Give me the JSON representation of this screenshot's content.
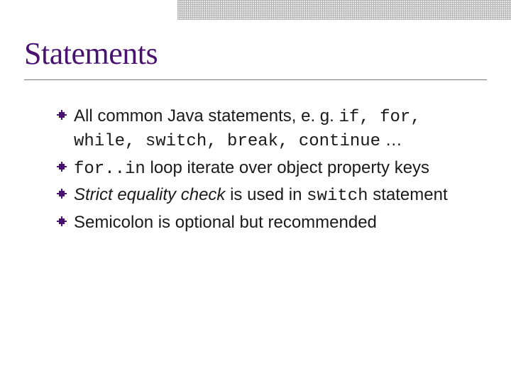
{
  "title": "Statements",
  "bullets": [
    {
      "parts": [
        {
          "t": "All common Java statements, e. g. "
        },
        {
          "t": "if, for, while, switch, break, continue",
          "code": true
        },
        {
          "t": " …"
        }
      ]
    },
    {
      "parts": [
        {
          "t": "for..in",
          "code": true
        },
        {
          "t": " loop iterate over object property keys"
        }
      ]
    },
    {
      "parts": [
        {
          "t": "Strict equality check",
          "ital": true
        },
        {
          "t": " is used in "
        },
        {
          "t": "switch",
          "code": true
        },
        {
          "t": " statement"
        }
      ]
    },
    {
      "parts": [
        {
          "t": "Semicolon is optional but recommended"
        }
      ]
    }
  ]
}
